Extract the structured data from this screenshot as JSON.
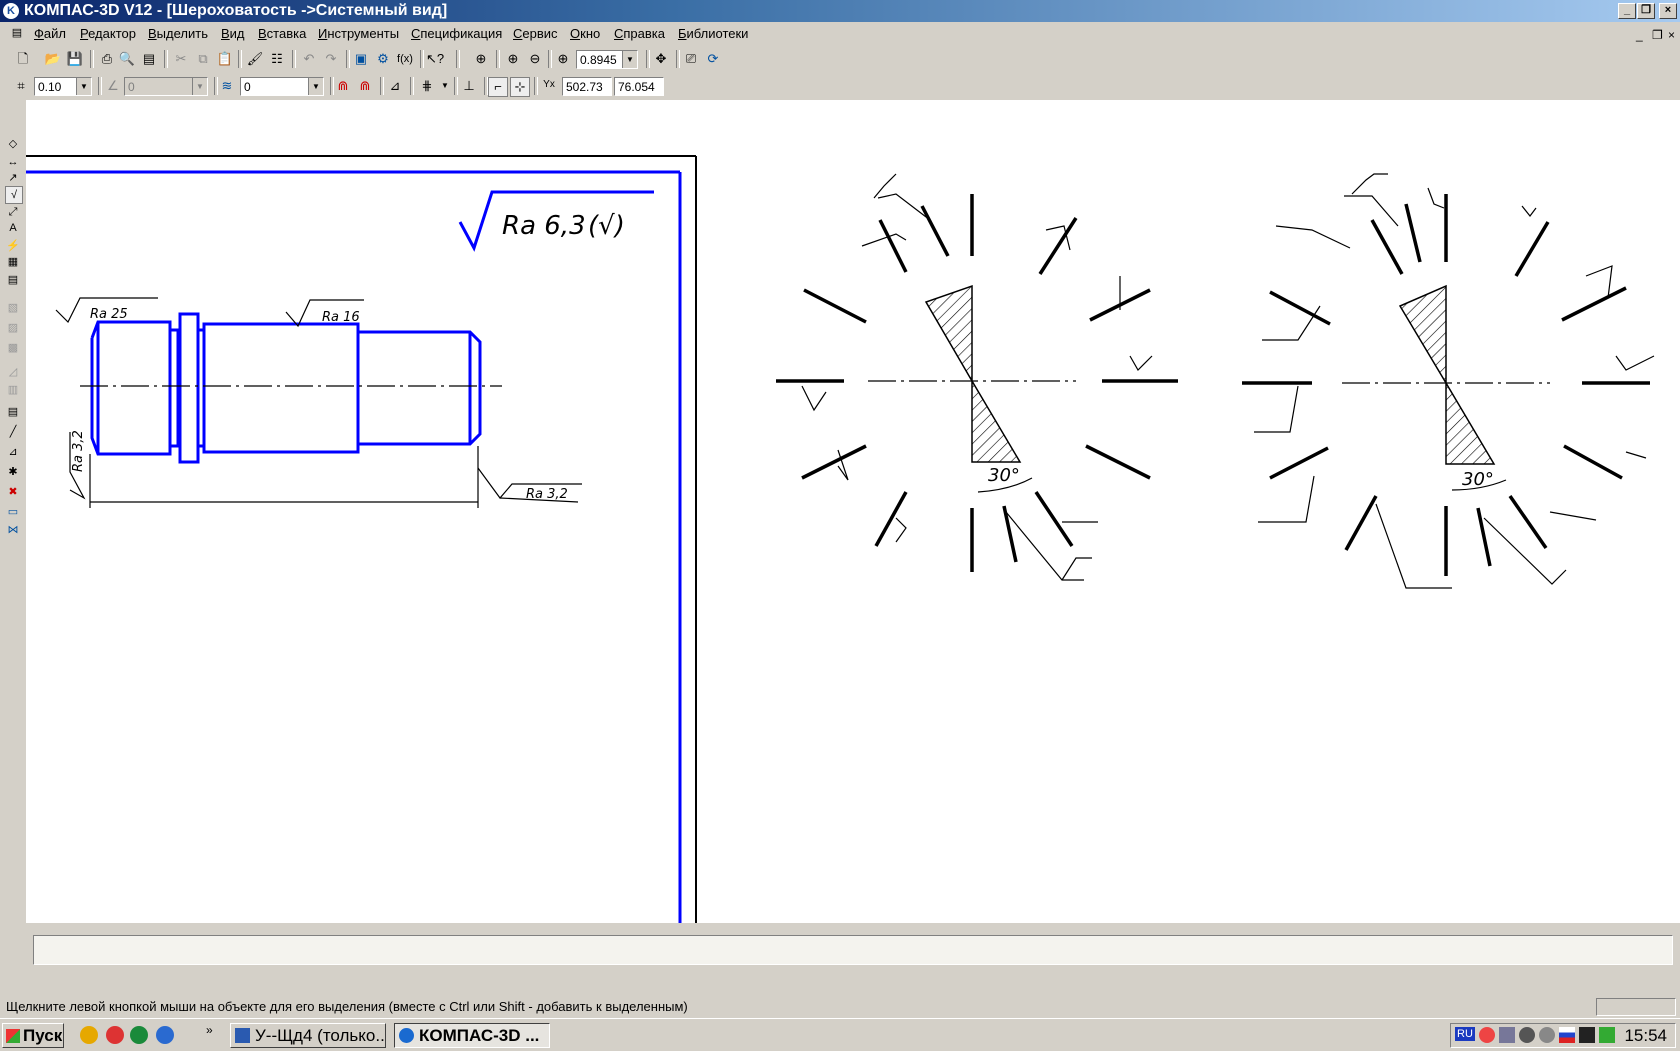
{
  "window": {
    "title": "КОМПАС-3D V12 - [Шероховатость ->Системный вид]",
    "app_icon": "kompas-logo-icon"
  },
  "menu": [
    "Файл",
    "Редактор",
    "Выделить",
    "Вид",
    "Вставка",
    "Инструменты",
    "Спецификация",
    "Сервис",
    "Окно",
    "Справка",
    "Библиотеки"
  ],
  "toolbar1": {
    "zoom_value": "0.8945"
  },
  "toolbar2": {
    "step_value": "0.10",
    "angle_value": "0",
    "layer_value": "0",
    "coord_x": "502.73",
    "coord_y": "76.054"
  },
  "drawing": {
    "general_roughness": "Ra 6,3",
    "general_roughness_suffix": "(√)",
    "shaft_labels": [
      "Ra 25",
      "Ra 16",
      "Ra 3,2",
      "Ra 3,2"
    ],
    "angle_label_1": "30°",
    "angle_label_2": "30°"
  },
  "status": {
    "hint": "Щелкните левой кнопкой мыши на объекте для его выделения (вместе с Ctrl или Shift - добавить к выделенным)"
  },
  "taskbar": {
    "start_label": "Пуск",
    "tasks": [
      "У--Щд4 (только...",
      "КОМПАС-3D ..."
    ],
    "clock": "15:54",
    "lang": "RU"
  }
}
